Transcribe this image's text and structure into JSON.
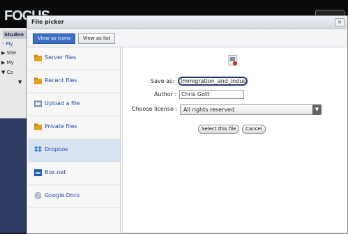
{
  "background": {
    "logo_text": "FOCUS",
    "tab_label": "Studen",
    "items": [
      "My",
      "Site",
      "My",
      "Co"
    ]
  },
  "dialog": {
    "title": "File picker",
    "close_symbol": "×",
    "view_buttons": {
      "icons": "View as icons",
      "list": "View as list"
    }
  },
  "repositories": [
    {
      "label": "Server files",
      "icon": "folder-icon"
    },
    {
      "label": "Recent files",
      "icon": "folder-icon"
    },
    {
      "label": "Upload a file",
      "icon": "upload-icon"
    },
    {
      "label": "Private files",
      "icon": "folder-icon"
    },
    {
      "label": "Dropbox",
      "icon": "dropbox-icon",
      "selected": true
    },
    {
      "label": "Box.net",
      "icon": "boxnet-icon"
    },
    {
      "label": "Google Docs",
      "icon": "google-icon"
    }
  ],
  "form": {
    "save_as_label": "Save as:",
    "save_as_value": "Immigration_and_Indust",
    "author_label": "Author :",
    "author_value": "Chris Gott",
    "license_label": "Choose license :",
    "license_value": "All rights reserved",
    "select_button": "Select this file",
    "cancel_button": "Cancel"
  },
  "colors": {
    "accent": "#3b6fc4",
    "link": "#2448a8",
    "selected_row": "#d9e4f3",
    "highlight_ring": "#24357f"
  }
}
